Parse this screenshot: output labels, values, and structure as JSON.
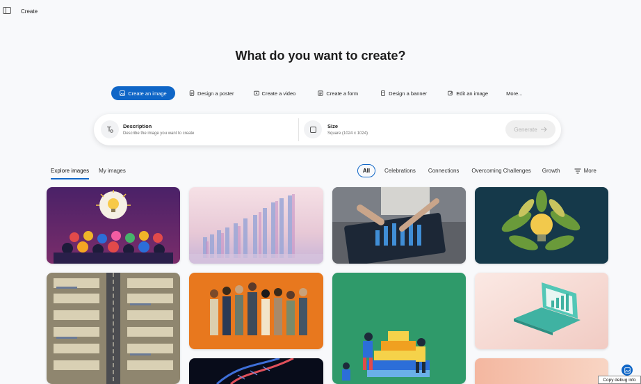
{
  "app": {
    "title": "Create"
  },
  "headline": "What do you want to create?",
  "actions": [
    {
      "label": "Create an image",
      "icon": "image-icon",
      "active": true
    },
    {
      "label": "Design a poster",
      "icon": "poster-icon"
    },
    {
      "label": "Create a video",
      "icon": "video-icon"
    },
    {
      "label": "Create a form",
      "icon": "form-icon"
    },
    {
      "label": "Design a banner",
      "icon": "banner-icon"
    },
    {
      "label": "Edit an image",
      "icon": "edit-image-icon"
    },
    {
      "label": "More..."
    }
  ],
  "prompt": {
    "description_label": "Description",
    "description_placeholder": "Describe the image you want to create",
    "size_label": "Size",
    "size_value": "Square (1024 x 1024)",
    "generate_label": "Generate"
  },
  "tabs": [
    {
      "label": "Explore images",
      "active": true
    },
    {
      "label": "My images"
    }
  ],
  "filters": [
    {
      "label": "All",
      "active": true
    },
    {
      "label": "Celebrations"
    },
    {
      "label": "Connections"
    },
    {
      "label": "Overcoming Challenges"
    },
    {
      "label": "Growth"
    },
    {
      "label": "More"
    }
  ],
  "gallery": [
    {
      "subject": "audience-lightbulb-idea",
      "palette": [
        "#5b2a7a",
        "#f7c948"
      ]
    },
    {
      "subject": "glass-bar-chart-reflection",
      "palette": [
        "#f2d7e0",
        "#7a8fc9"
      ]
    },
    {
      "subject": "hand-tablet-holographic-chart",
      "palette": [
        "#1e2a38",
        "#49a6ff"
      ]
    },
    {
      "subject": "lightbulb-leaves",
      "palette": [
        "#163a4a",
        "#f2c94c"
      ]
    },
    {
      "subject": "aerial-warehouses-road",
      "palette": [
        "#8a8270",
        "#d8cfb8"
      ]
    },
    {
      "subject": "diverse-team-standing",
      "palette": [
        "#e8781e",
        "#f5e6c8"
      ]
    },
    {
      "subject": "people-building-blocks",
      "palette": [
        "#2f9a6a",
        "#f5d24a"
      ]
    },
    {
      "subject": "laptop-chart-pink",
      "palette": [
        "#f3d9d4",
        "#4cc2b2"
      ]
    },
    {
      "subject": "dna-helix-dark",
      "palette": [
        "#0a0f1e",
        "#3e6fd8"
      ]
    },
    {
      "subject": "peach-gradient",
      "palette": [
        "#f4b7a0",
        "#f8d5c4"
      ]
    }
  ],
  "colors": {
    "accent": "#0f66c7"
  },
  "fab": {
    "icon": "image-icon"
  },
  "debug_label": "Copy debug info"
}
